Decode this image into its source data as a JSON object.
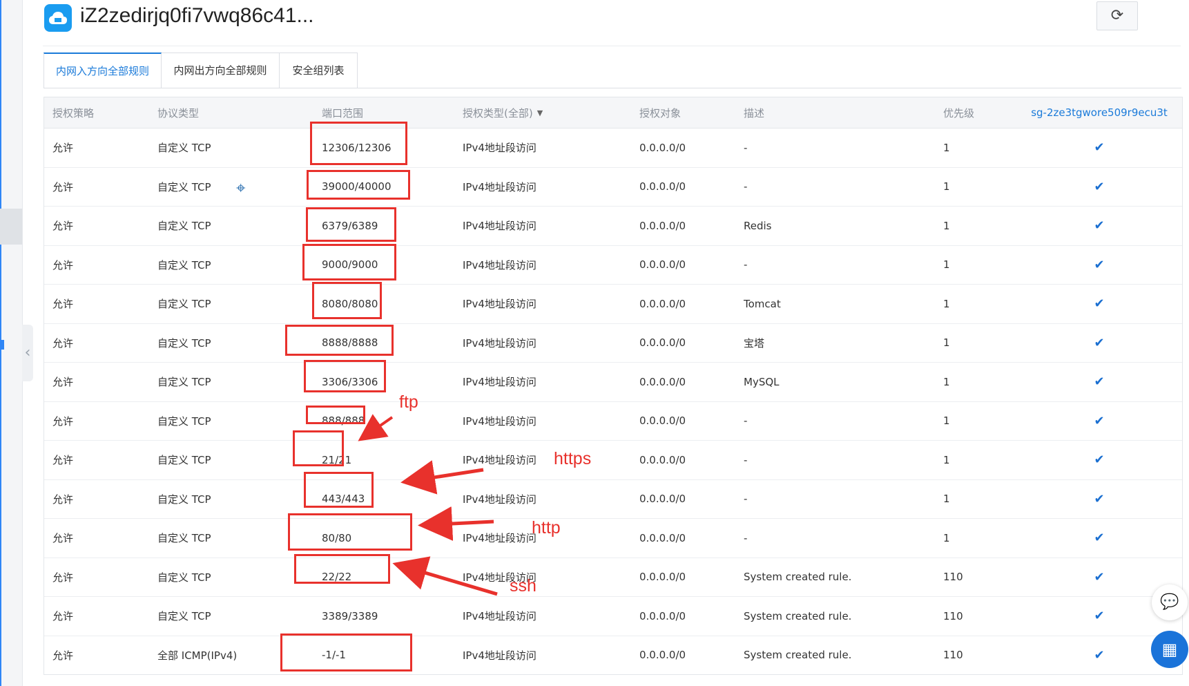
{
  "header": {
    "title": "iZ2zedirjq0fi7vwq86c41...",
    "refresh_icon": "refresh-icon",
    "logo_icon": "cloud-icon",
    "colors": {
      "logo_bg": "#1a9cf0",
      "accent": "#1a7ad9"
    }
  },
  "tabs": [
    {
      "label": "内网入方向全部规则",
      "active": true
    },
    {
      "label": "内网出方向全部规则",
      "active": false
    },
    {
      "label": "安全组列表",
      "active": false
    }
  ],
  "table": {
    "columns": [
      "授权策略",
      "协议类型",
      "端口范围",
      "授权类型(全部)",
      "授权对象",
      "描述",
      "优先级",
      "sg-2ze3tgwore509r9ecu3t"
    ],
    "rows": [
      {
        "policy": "允许",
        "protocol": "自定义 TCP",
        "port": "12306/12306",
        "auth_type": "IPv4地址段访问",
        "object": "0.0.0.0/0",
        "desc": "-",
        "priority": "1",
        "checked": true
      },
      {
        "policy": "允许",
        "protocol": "自定义 TCP",
        "port": "39000/40000",
        "auth_type": "IPv4地址段访问",
        "object": "0.0.0.0/0",
        "desc": "-",
        "priority": "1",
        "checked": true
      },
      {
        "policy": "允许",
        "protocol": "自定义 TCP",
        "port": "6379/6389",
        "auth_type": "IPv4地址段访问",
        "object": "0.0.0.0/0",
        "desc": "Redis",
        "priority": "1",
        "checked": true
      },
      {
        "policy": "允许",
        "protocol": "自定义 TCP",
        "port": "9000/9000",
        "auth_type": "IPv4地址段访问",
        "object": "0.0.0.0/0",
        "desc": "-",
        "priority": "1",
        "checked": true
      },
      {
        "policy": "允许",
        "protocol": "自定义 TCP",
        "port": "8080/8080",
        "auth_type": "IPv4地址段访问",
        "object": "0.0.0.0/0",
        "desc": "Tomcat",
        "priority": "1",
        "checked": true
      },
      {
        "policy": "允许",
        "protocol": "自定义 TCP",
        "port": "8888/8888",
        "auth_type": "IPv4地址段访问",
        "object": "0.0.0.0/0",
        "desc": "宝塔",
        "priority": "1",
        "checked": true
      },
      {
        "policy": "允许",
        "protocol": "自定义 TCP",
        "port": "3306/3306",
        "auth_type": "IPv4地址段访问",
        "object": "0.0.0.0/0",
        "desc": "MySQL",
        "priority": "1",
        "checked": true
      },
      {
        "policy": "允许",
        "protocol": "自定义 TCP",
        "port": "888/888",
        "auth_type": "IPv4地址段访问",
        "object": "0.0.0.0/0",
        "desc": "-",
        "priority": "1",
        "checked": true
      },
      {
        "policy": "允许",
        "protocol": "自定义 TCP",
        "port": "21/21",
        "auth_type": "IPv4地址段访问",
        "object": "0.0.0.0/0",
        "desc": "-",
        "priority": "1",
        "checked": true
      },
      {
        "policy": "允许",
        "protocol": "自定义 TCP",
        "port": "443/443",
        "auth_type": "IPv4地址段访问",
        "object": "0.0.0.0/0",
        "desc": "-",
        "priority": "1",
        "checked": true
      },
      {
        "policy": "允许",
        "protocol": "自定义 TCP",
        "port": "80/80",
        "auth_type": "IPv4地址段访问",
        "object": "0.0.0.0/0",
        "desc": "-",
        "priority": "1",
        "checked": true
      },
      {
        "policy": "允许",
        "protocol": "自定义 TCP",
        "port": "22/22",
        "auth_type": "IPv4地址段访问",
        "object": "0.0.0.0/0",
        "desc": "System created rule.",
        "priority": "110",
        "checked": true
      },
      {
        "policy": "允许",
        "protocol": "自定义 TCP",
        "port": "3389/3389",
        "auth_type": "IPv4地址段访问",
        "object": "0.0.0.0/0",
        "desc": "System created rule.",
        "priority": "110",
        "checked": true
      },
      {
        "policy": "允许",
        "protocol": "全部 ICMP(IPv4)",
        "port": "-1/-1",
        "auth_type": "IPv4地址段访问",
        "object": "0.0.0.0/0",
        "desc": "System created rule.",
        "priority": "110",
        "checked": true
      }
    ]
  },
  "annotations": {
    "ftp": "ftp",
    "https": "https",
    "http": "http",
    "ssh": "ssh",
    "color": "#e8312c"
  },
  "floating": {
    "chat_icon": "chat-icon",
    "apps_icon": "apps-grid-icon"
  }
}
